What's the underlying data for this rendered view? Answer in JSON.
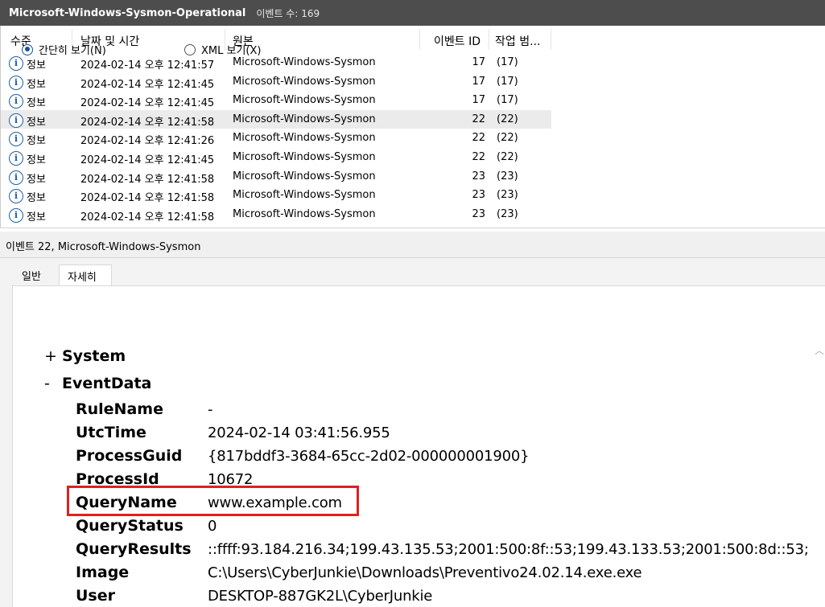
{
  "titlebar": {
    "log_name": "Microsoft-Windows-Sysmon-Operational",
    "event_count": "이벤트 수: 169"
  },
  "columns": {
    "level": "수준",
    "datetime": "날짜 및 시간",
    "source": "원본",
    "event_id": "이벤트 ID",
    "task": "작업 범..."
  },
  "rows": [
    {
      "level": "정보",
      "datetime": "2024-02-14 오후 12:41:57",
      "source": "Microsoft-Windows-Sysmon",
      "event_id": "17",
      "task": "(17)"
    },
    {
      "level": "정보",
      "datetime": "2024-02-14 오후 12:41:45",
      "source": "Microsoft-Windows-Sysmon",
      "event_id": "17",
      "task": "(17)"
    },
    {
      "level": "정보",
      "datetime": "2024-02-14 오후 12:41:45",
      "source": "Microsoft-Windows-Sysmon",
      "event_id": "17",
      "task": "(17)"
    },
    {
      "level": "정보",
      "datetime": "2024-02-14 오후 12:41:58",
      "source": "Microsoft-Windows-Sysmon",
      "event_id": "22",
      "task": "(22)"
    },
    {
      "level": "정보",
      "datetime": "2024-02-14 오후 12:41:26",
      "source": "Microsoft-Windows-Sysmon",
      "event_id": "22",
      "task": "(22)"
    },
    {
      "level": "정보",
      "datetime": "2024-02-14 오후 12:41:45",
      "source": "Microsoft-Windows-Sysmon",
      "event_id": "22",
      "task": "(22)"
    },
    {
      "level": "정보",
      "datetime": "2024-02-14 오후 12:41:58",
      "source": "Microsoft-Windows-Sysmon",
      "event_id": "23",
      "task": "(23)"
    },
    {
      "level": "정보",
      "datetime": "2024-02-14 오후 12:41:58",
      "source": "Microsoft-Windows-Sysmon",
      "event_id": "23",
      "task": "(23)"
    },
    {
      "level": "정보",
      "datetime": "2024-02-14 오후 12:41:58",
      "source": "Microsoft-Windows-Sysmon",
      "event_id": "23",
      "task": "(23)"
    }
  ],
  "info_icon_glyph": "i",
  "selected_row": 3,
  "detail": {
    "header": "이벤트 22, Microsoft-Windows-Sysmon",
    "tab_general": "일반",
    "tab_details": "자세히",
    "radio_friendly": "간단히 보기(N)",
    "radio_xml": "XML 보기(X)",
    "section_system": "System",
    "section_system_sign": "+",
    "section_eventdata": "EventData",
    "section_eventdata_sign": "-",
    "fields": [
      {
        "name": "RuleName",
        "value": "-"
      },
      {
        "name": "UtcTime",
        "value": "2024-02-14 03:41:56.955"
      },
      {
        "name": "ProcessGuid",
        "value": "{817bddf3-3684-65cc-2d02-000000001900}"
      },
      {
        "name": "ProcessId",
        "value": "10672"
      },
      {
        "name": "QueryName",
        "value": "www.example.com"
      },
      {
        "name": "QueryStatus",
        "value": "0"
      },
      {
        "name": "QueryResults",
        "value": "::ffff:93.184.216.34;199.43.135.53;2001:500:8f::53;199.43.133.53;2001:500:8d::53;"
      },
      {
        "name": "Image",
        "value": "C:\\Users\\CyberJunkie\\Downloads\\Preventivo24.02.14.exe.exe"
      },
      {
        "name": "User",
        "value": "DESKTOP-887GK2L\\CyberJunkie"
      }
    ]
  },
  "colors": {
    "titlebar_bg": "#4d4d4d",
    "info_icon": "#1f5fa8",
    "highlight": "#e02020"
  },
  "icons": {
    "info": "info-icon",
    "sort": "sort-ascending-icon",
    "scroll_up": "scroll-up-icon"
  }
}
